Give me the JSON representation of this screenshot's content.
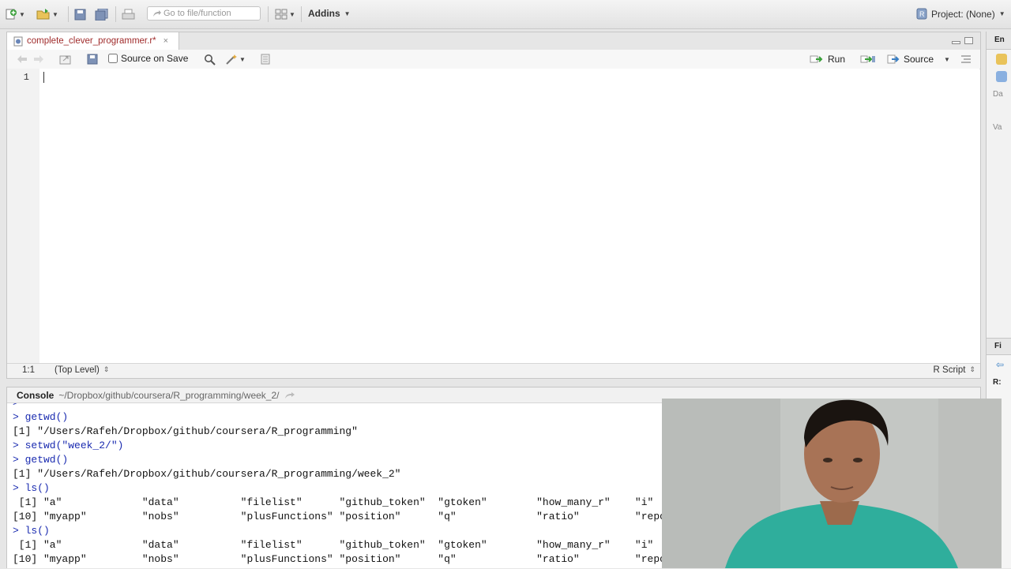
{
  "toolbar": {
    "goto_placeholder": "Go to file/function",
    "addins_label": "Addins",
    "project_label": "Project: (None)"
  },
  "editor": {
    "tab_filename": "complete_clever_programmer.r*",
    "source_on_save_label": "Source on Save",
    "run_label": "Run",
    "source_label": "Source",
    "line_number": "1",
    "cursor_position": "1:1",
    "scope": "(Top Level)",
    "file_type": "R Script"
  },
  "right_pane": {
    "top_tab": "En",
    "label_da": "Da",
    "label_va": "Va",
    "bottom_tab": "Fi",
    "label_r": "R:"
  },
  "console": {
    "title": "Console",
    "path": "~/Dropbox/github/coursera/R_programming/week_2/",
    "lines": [
      {
        "type": "cmd",
        "text": ">"
      },
      {
        "type": "cmd",
        "text": "> getwd()"
      },
      {
        "type": "out",
        "text": "[1] \"/Users/Rafeh/Dropbox/github/coursera/R_programming\""
      },
      {
        "type": "cmd",
        "text": "> setwd(\"week_2/\")"
      },
      {
        "type": "cmd",
        "text": "> getwd()"
      },
      {
        "type": "out",
        "text": "[1] \"/Users/Rafeh/Dropbox/github/coursera/R_programming/week_2\""
      },
      {
        "type": "cmd",
        "text": "> ls()"
      },
      {
        "type": "out",
        "text": " [1] \"a\"             \"data\"          \"filelist\"      \"github_token\"  \"gtoken\"        \"how_many_r\"    \"i\""
      },
      {
        "type": "out",
        "text": "[10] \"myapp\"         \"nobs\"          \"plusFunctions\" \"position\"      \"q\"             \"ratio\"         \"repo"
      },
      {
        "type": "cmd",
        "text": "> ls()"
      },
      {
        "type": "out",
        "text": " [1] \"a\"             \"data\"          \"filelist\"      \"github_token\"  \"gtoken\"        \"how_many_r\"    \"i\""
      },
      {
        "type": "out",
        "text": "[10] \"myapp\"         \"nobs\"          \"plusFunctions\" \"position\"      \"q\"             \"ratio\"         \"repo"
      }
    ]
  },
  "colors": {
    "console_command": "#1a2bb0",
    "tab_filename": "#a02c2c",
    "webcam_shirt": "#2fae9c"
  }
}
